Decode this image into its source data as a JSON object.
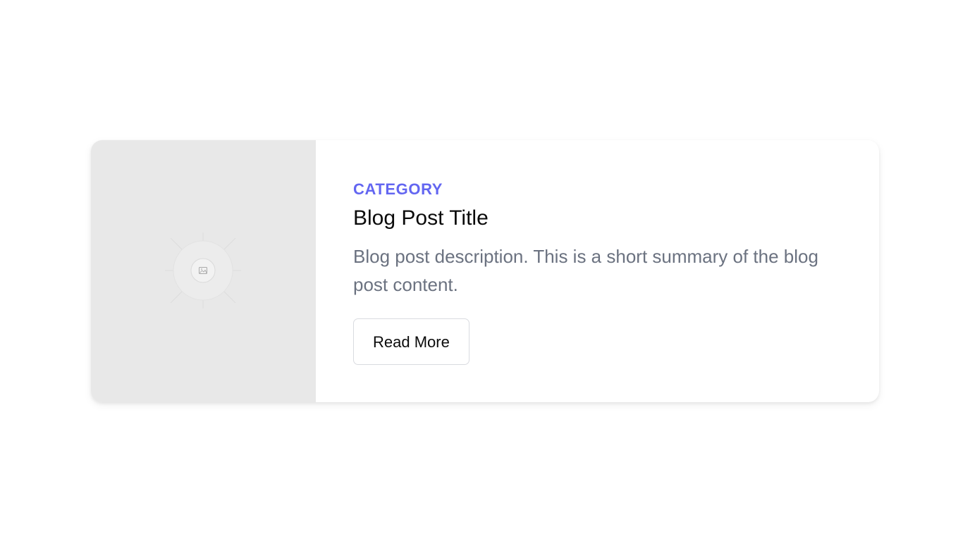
{
  "post": {
    "category": "CATEGORY",
    "title": "Blog Post Title",
    "description": "Blog post description. This is a short summary of the blog post content.",
    "read_more_label": "Read More"
  },
  "image": {
    "icon": "image-placeholder-icon"
  },
  "colors": {
    "accent": "#6366f1",
    "title": "#0b0b0b",
    "description": "#6b7280",
    "image_bg": "#e8e8e8"
  }
}
